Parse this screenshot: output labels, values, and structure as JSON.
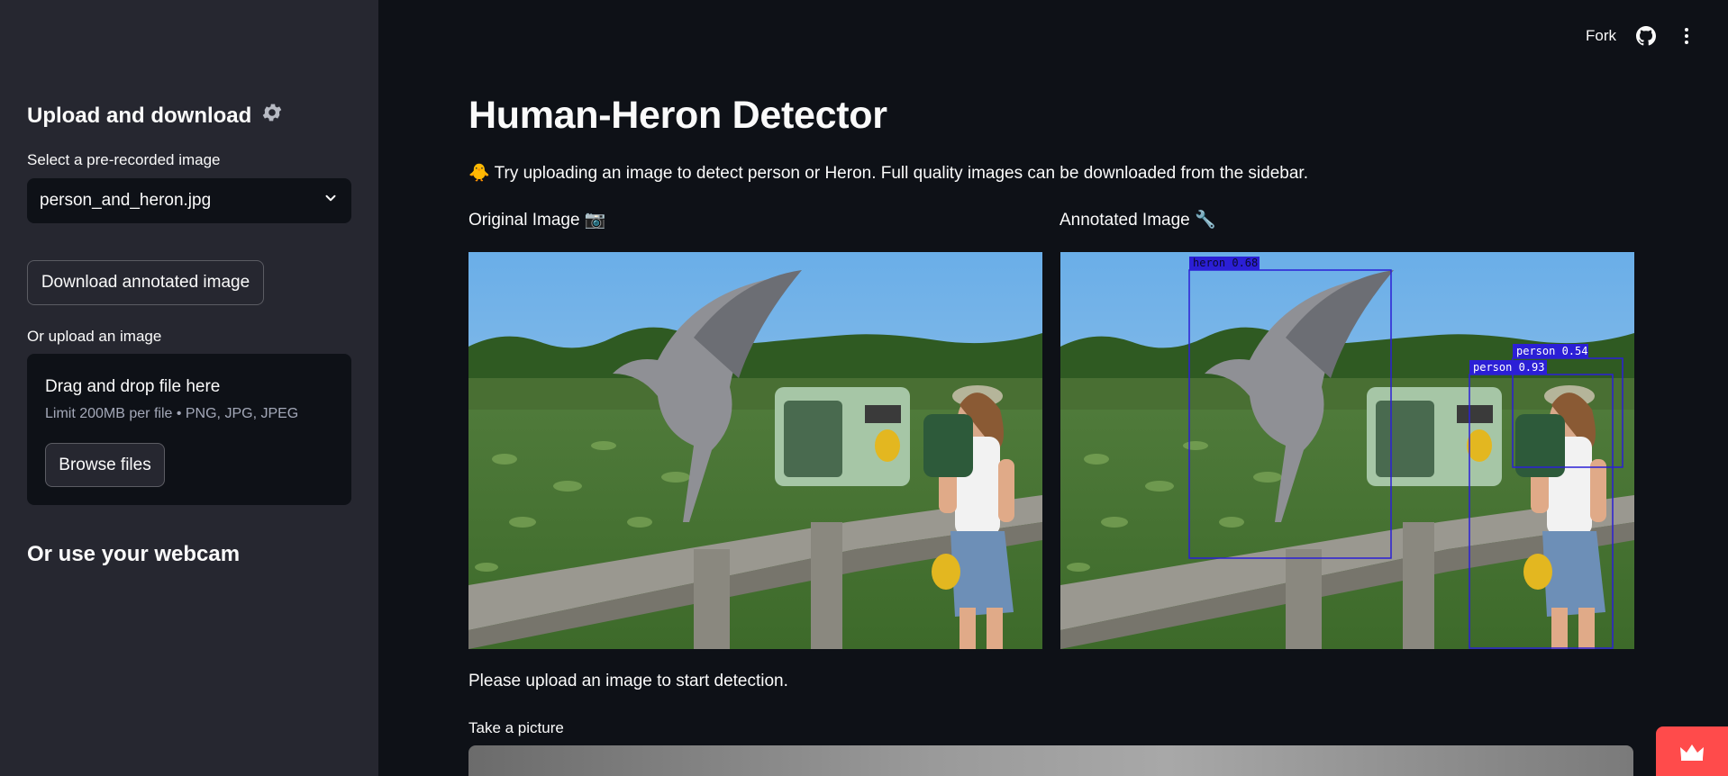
{
  "sidebar": {
    "title": "Upload and download",
    "select_label": "Select a pre-recorded image",
    "select_value": "person_and_heron.jpg",
    "download_button": "Download annotated image",
    "upload_label": "Or upload an image",
    "dropzone_title": "Drag and drop file here",
    "dropzone_limit": "Limit 200MB per file • PNG, JPG, JPEG",
    "browse_button": "Browse files",
    "webcam_heading": "Or use your webcam"
  },
  "topbar": {
    "fork_label": "Fork",
    "icons": [
      "github-icon",
      "more-vertical-icon"
    ]
  },
  "main": {
    "title": "Human-Heron Detector",
    "info_emoji": "🐥",
    "info_text": "Try uploading an image to detect person or Heron. Full quality images can be downloaded from the sidebar.",
    "original_caption": "Original Image 📷",
    "annotated_caption": "Annotated Image 🔧",
    "detections": [
      {
        "label": "heron 0.68"
      },
      {
        "label": "person 0.54"
      },
      {
        "label": "person 0.93"
      }
    ],
    "status_text": "Please upload an image to start detection.",
    "camera_label": "Take a picture"
  },
  "colors": {
    "background": "#0e1117",
    "sidebar": "#262730",
    "accent": "#ff4b4b",
    "box": "#2b1fd6"
  }
}
